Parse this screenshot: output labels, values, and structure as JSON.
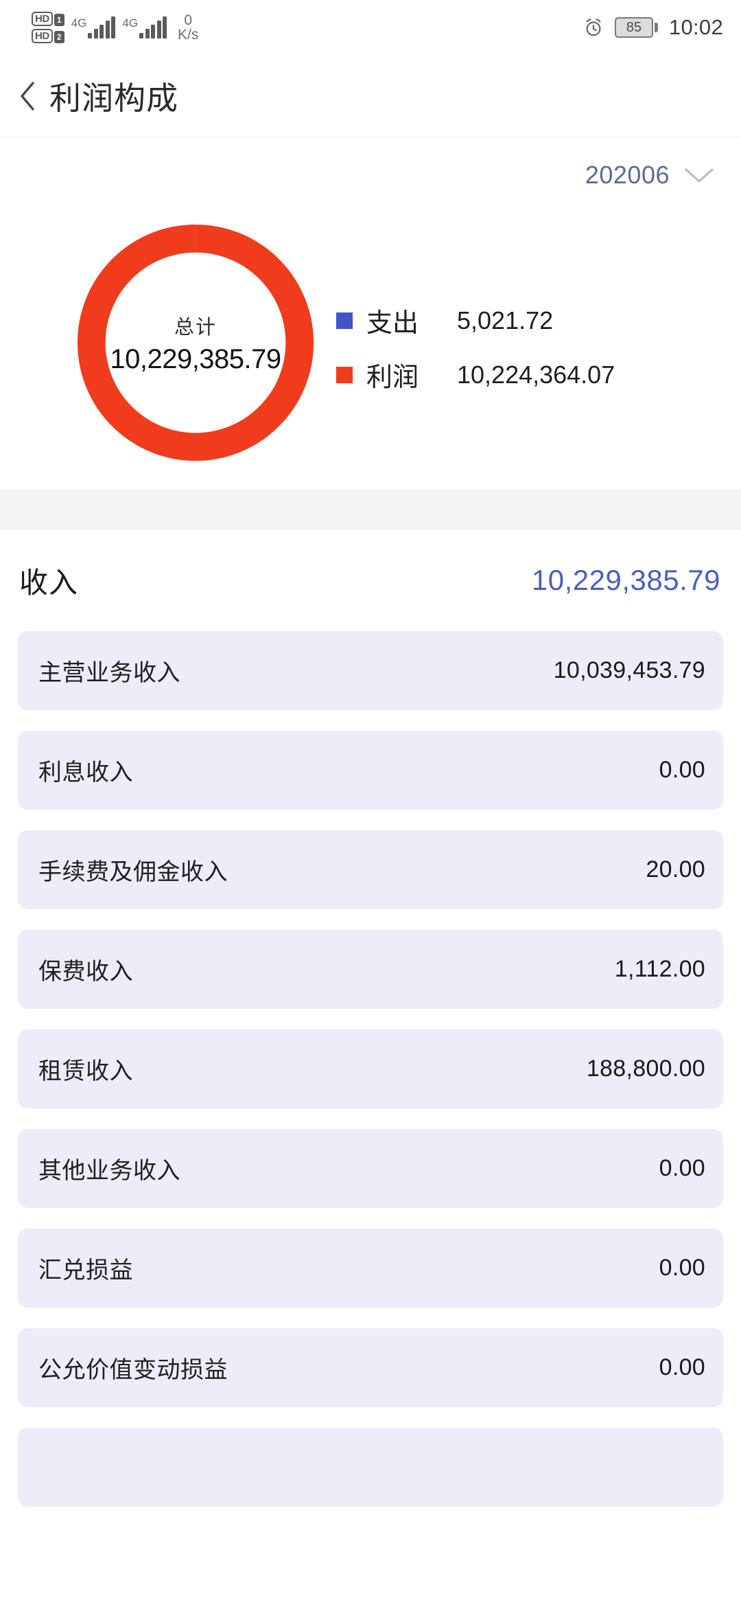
{
  "statusbar": {
    "hd1_label": "HD",
    "hd1_sim": "1",
    "hd2_label": "HD",
    "hd2_sim": "2",
    "net1_label": "4G",
    "net2_label": "4G",
    "netspeed_value": "0",
    "netspeed_unit": "K/s",
    "alarm_icon": "alarm-clock-icon",
    "battery_level": "85",
    "time": "10:02"
  },
  "navbar": {
    "back_icon": "chevron-left-icon",
    "title": "利润构成"
  },
  "period": {
    "value": "202006",
    "chevron_icon": "chevron-down-icon",
    "color": "#5d6b93"
  },
  "chart_data": {
    "type": "pie",
    "title": "总计",
    "center_label": "总计",
    "center_value": "10,229,385.79",
    "total": 10229385.79,
    "categories": [
      "支出",
      "利润"
    ],
    "values": [
      5021.72,
      10224364.07
    ],
    "value_labels": [
      "5,021.72",
      "10,224,364.07"
    ],
    "colors": [
      "#4055c8",
      "#f03c1c"
    ],
    "percentages": [
      0.05,
      99.95
    ],
    "legend_position": "right",
    "donut": true,
    "grid": false
  },
  "section": {
    "title": "收入",
    "value": "10,229,385.79",
    "value_color": "#4a5fbe"
  },
  "rows": [
    {
      "label": "主营业务收入",
      "value": "10,039,453.79"
    },
    {
      "label": "利息收入",
      "value": "0.00"
    },
    {
      "label": "手续费及佣金收入",
      "value": "20.00"
    },
    {
      "label": "保费收入",
      "value": "1,112.00"
    },
    {
      "label": "租赁收入",
      "value": "188,800.00"
    },
    {
      "label": "其他业务收入",
      "value": "0.00"
    },
    {
      "label": "汇兑损益",
      "value": "0.00"
    },
    {
      "label": "公允价值变动损益",
      "value": "0.00"
    },
    {
      "label": "",
      "value": ""
    }
  ]
}
